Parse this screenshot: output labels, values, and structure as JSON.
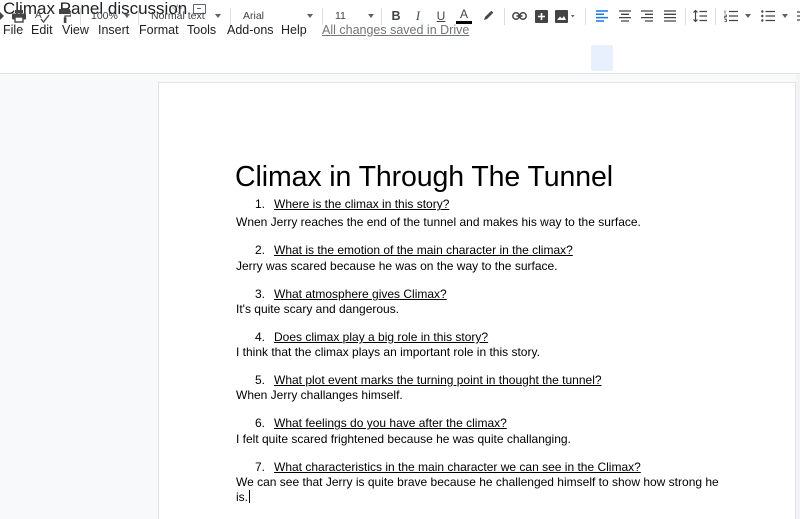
{
  "titlebar": {
    "doc_title": "Climax Panel discussion",
    "star_icon": "☆"
  },
  "menubar": {
    "items": [
      "File",
      "Edit",
      "View",
      "Insert",
      "Format",
      "Tools",
      "Add-ons",
      "Help"
    ],
    "save_status": "All changes saved in Drive"
  },
  "toolbar": {
    "zoom": "100%",
    "style": "Normal text",
    "font": "Arial",
    "font_size": "11",
    "bold": "B",
    "italic": "I",
    "underline": "U",
    "text_color": "A",
    "text_color_value": "#000000",
    "accent": "#1a73e8"
  },
  "document": {
    "heading": "Climax in Through The Tunnel",
    "items": [
      {
        "num": "1.",
        "question": "Where is the climax in this story?",
        "answer": "Wnen Jerry reaches the end of the tunnel and makes his way to the surface."
      },
      {
        "num": "2.",
        "question": "What is the emotion of the main character in the climax?",
        "answer": "Jerry was scared because he was on the way to the surface."
      },
      {
        "num": "3.",
        "question": "What atmosphere gives Climax?",
        "answer": "It's quite scary and dangerous."
      },
      {
        "num": "4.",
        "question": "Does climax play a big role in this story?",
        "answer": "I think that the climax plays an important role in this story."
      },
      {
        "num": "5.",
        "question": "What plot event marks the turning point in thought the tunnel?",
        "answer": "When Jerry challanges himself."
      },
      {
        "num": "6.",
        "question": "What feelings do you have after the climax?",
        "answer": "I felt quite scared frightened because he was quite challanging."
      },
      {
        "num": "7.",
        "question": "What characteristics in the main character we can see in the Climax?",
        "answer_line1": "We can see that Jerry is quite brave because he challenged himself to show how strong he",
        "answer_line2": "is."
      }
    ]
  }
}
